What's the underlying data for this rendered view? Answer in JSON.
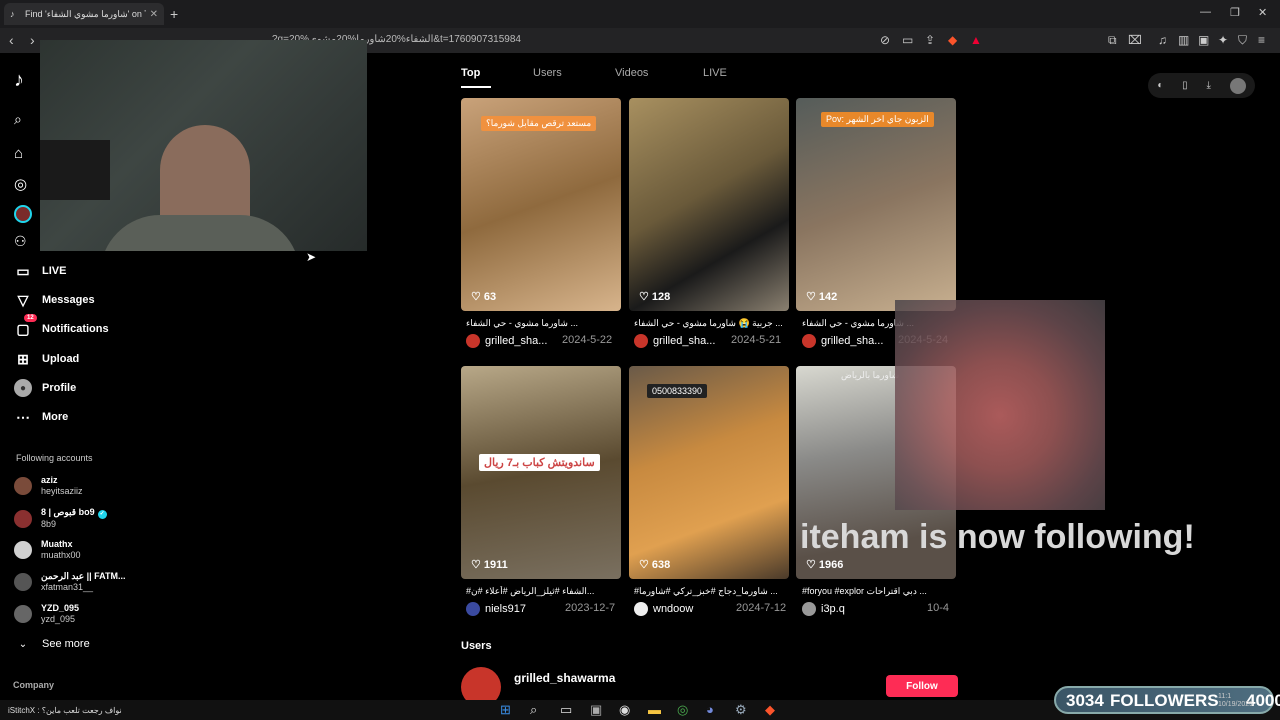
{
  "browser": {
    "tab_title": "Find 'شاورما مشوي الشفاء' on Tik...",
    "url": "?q=الشفاء%20شاورما%20مشوي%20&t=1760907315984"
  },
  "sidebar": {
    "logo": "♪",
    "nav": [
      {
        "label": "LIVE",
        "icon": "live-icon"
      },
      {
        "label": "Messages",
        "icon": "messages-icon"
      },
      {
        "label": "Notifications",
        "icon": "notifications-icon",
        "badge": "12"
      },
      {
        "label": "Upload",
        "icon": "upload-icon"
      },
      {
        "label": "Profile",
        "icon": "profile-icon"
      },
      {
        "label": "More",
        "icon": "more-icon"
      }
    ],
    "following_title": "Following accounts",
    "accounts": [
      {
        "name": "aziz",
        "handle": "heyitsaziiz",
        "color": "#7a4b3a"
      },
      {
        "name": "8 | قبوص bo9",
        "handle": "8b9",
        "color": "#8a3030",
        "verified": true
      },
      {
        "name": "Muathx",
        "handle": "muathx00",
        "color": "#d0d0d0"
      },
      {
        "name": "عبد الرحمن || FATM...",
        "handle": "xfatman31__",
        "color": "#555"
      },
      {
        "name": "YZD_095",
        "handle": "yzd_095",
        "color": "#666"
      }
    ],
    "see_more": "See more",
    "company": "Company"
  },
  "search": {
    "tabs": [
      "Top",
      "Users",
      "Videos",
      "LIVE"
    ]
  },
  "videos": [
    {
      "likes": "63",
      "caption": "شاورما مشوي - حي الشفاء ...",
      "author": "grilled_sha...",
      "date": "2024-5-22",
      "overlay": "مستعد ترقص مقابل شورما؟"
    },
    {
      "likes": "128",
      "caption": "جربية 😭 شاورما مشوي - حي الشفاء ...",
      "author": "grilled_sha...",
      "date": "2024-5-21",
      "overlay": ""
    },
    {
      "likes": "142",
      "caption": "شاورما مشوي - حي الشفاء ...",
      "author": "grilled_sha...",
      "date": "2024-5-24",
      "overlay": "Pov: الزبون جاي اخر الشهر"
    },
    {
      "likes": "1911",
      "caption": "#الشفاء #ثيلز_الرياض #أعلاء #ن...",
      "author": "niels917",
      "date": "2023-12-7",
      "overlay": "ساندويتش كباب بـ7 ريال"
    },
    {
      "likes": "638",
      "caption": "#شاورما_دجاج #خبز_تركي #شاورما ...",
      "author": "wndoow",
      "date": "2024-7-12",
      "overlay": "0500833390"
    },
    {
      "likes": "1966",
      "caption": "#foryou #explor دبي اقتراحات ...",
      "author": "i3p.q",
      "date": "10-4",
      "overlay": "شاورما بالرياض"
    }
  ],
  "users_section": {
    "title": "Users",
    "user_name": "grilled_shawarma",
    "follow_label": "Follow"
  },
  "stream": {
    "follow_alert": "iteham is now following!",
    "followers_count": "3034",
    "followers_label": "FOLLOWERS",
    "followers_goal": "4000",
    "chat_line": "iStitchX : نواف رجعت تلعب ماين؟",
    "clock_time": "11:1",
    "clock_date": "10/19/2025"
  }
}
